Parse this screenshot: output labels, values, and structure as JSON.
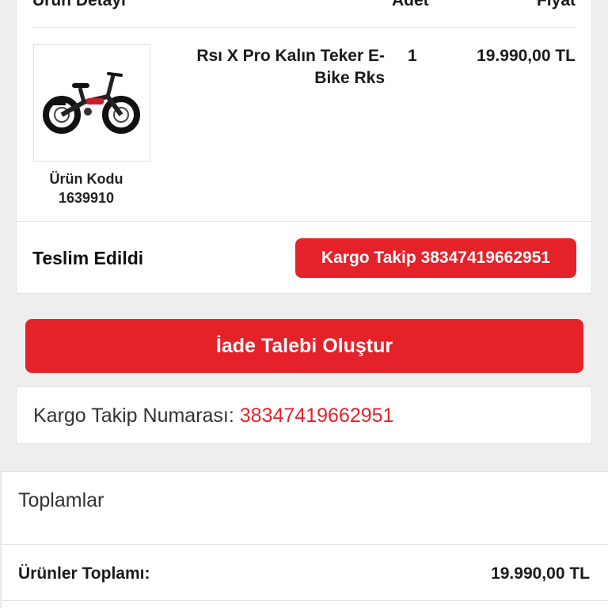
{
  "order": {
    "headers": {
      "detail": "Ürün Detayı",
      "quantity": "Adet",
      "price": "Fiyat"
    },
    "item": {
      "name": "Rsı X Pro Kalın Teker E-Bike Rks",
      "quantity": "1",
      "price": "19.990,00 TL",
      "code_label": "Ürün Kodu",
      "code": "1639910",
      "image_icon": "e-bike-image"
    },
    "status": "Teslim Edildi",
    "tracking_button": "Kargo Takip 38347419662951"
  },
  "return_button": "İade Talebi Oluştur",
  "tracking": {
    "label": "Kargo Takip Numarası:",
    "number": "38347419662951"
  },
  "totals": {
    "title": "Toplamlar",
    "products_total_label": "Ürünler Toplamı:",
    "products_total_value": "19.990,00 TL"
  },
  "colors": {
    "accent": "#e5222a",
    "background": "#eeeeee",
    "card": "#ffffff"
  }
}
